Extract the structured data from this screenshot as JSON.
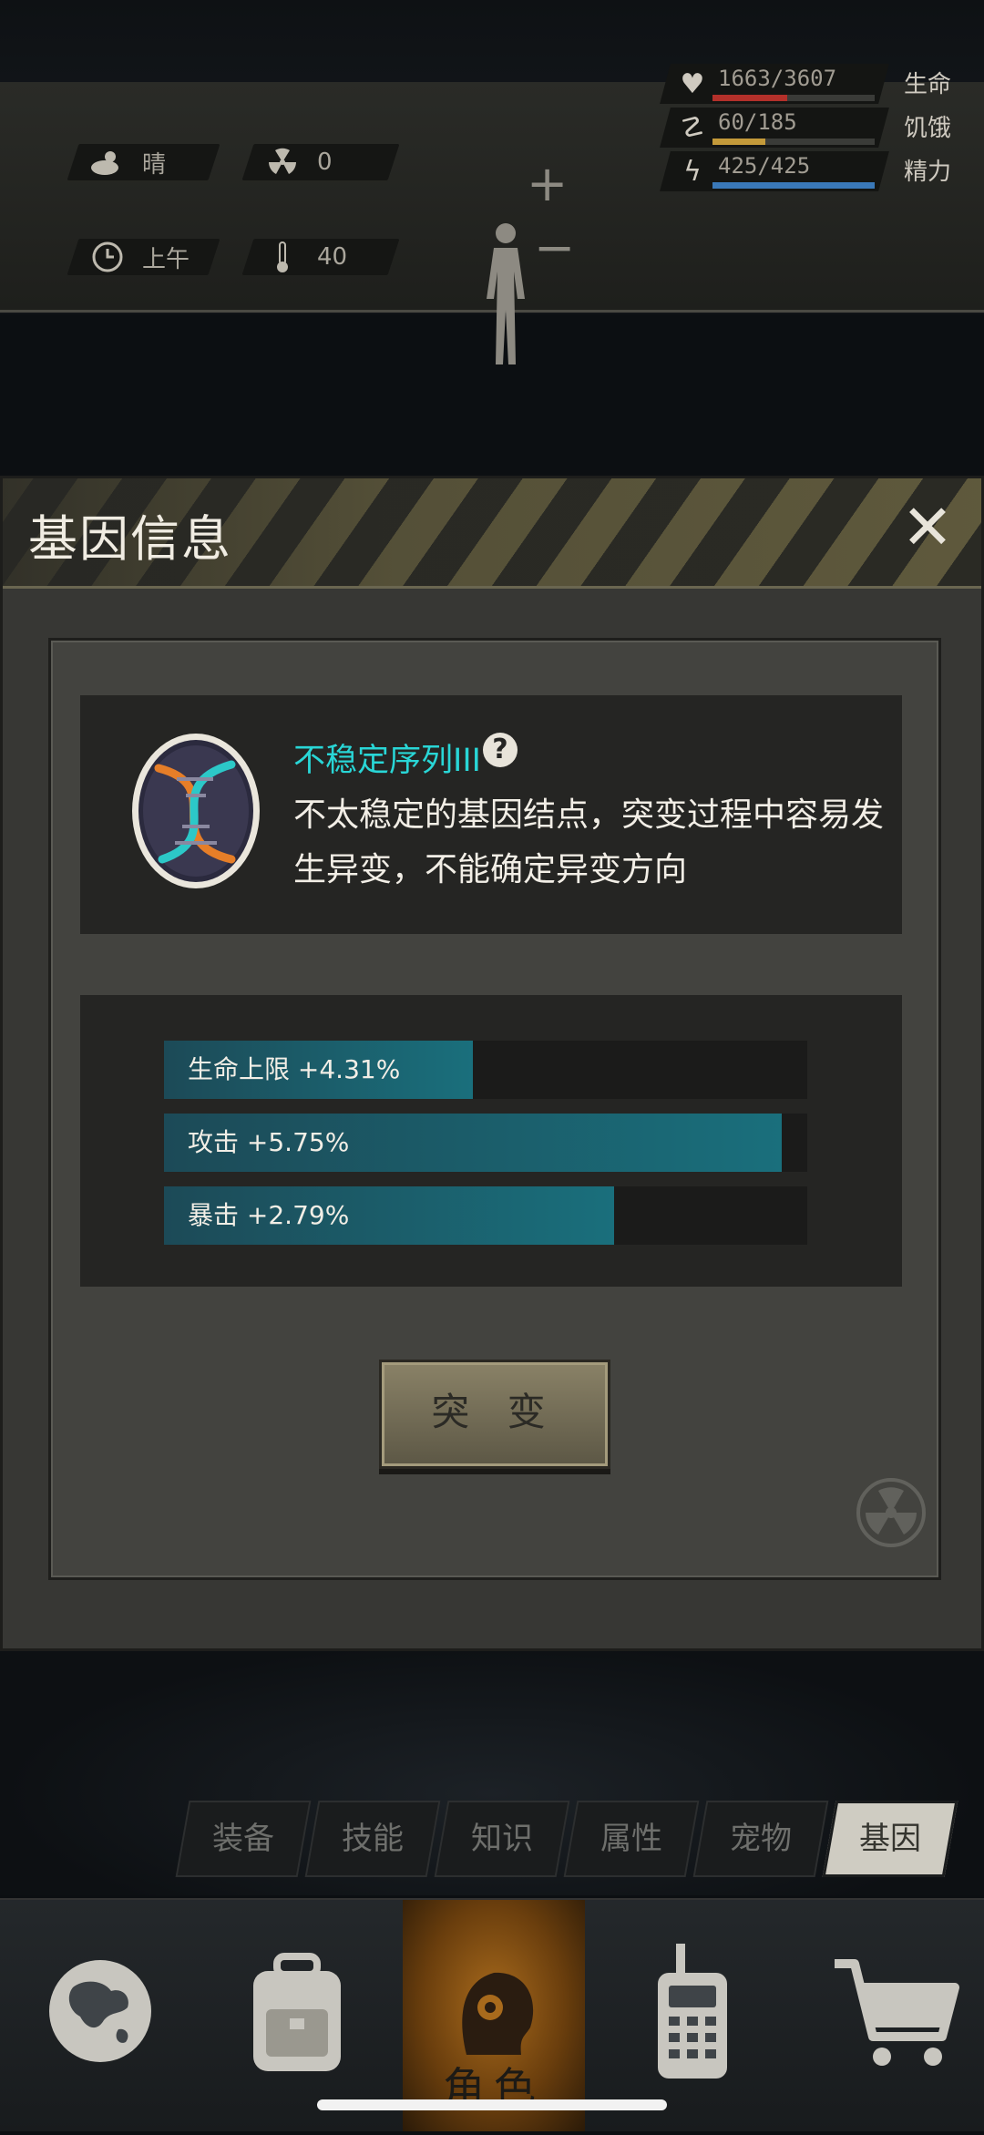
{
  "status": {
    "weather": "晴",
    "radiation": "0",
    "time_of_day": "上午",
    "temperature": "40",
    "stats": [
      {
        "name": "生命",
        "value": "1663/3607",
        "fraction": 0.461,
        "color": "#b3302a",
        "icon": "heart-icon"
      },
      {
        "name": "饥饿",
        "value": "60/185",
        "fraction": 0.324,
        "color": "#c49a3a",
        "icon": "stomach-icon"
      },
      {
        "name": "精力",
        "value": "425/425",
        "fraction": 1.0,
        "color": "#3a78b8",
        "icon": "energy-icon"
      }
    ]
  },
  "dialog": {
    "title": "基因信息",
    "gene": {
      "name": "不稳定序列III",
      "description": "不太稳定的基因结点，突变过程中容易发生异变，不能确定异变方向"
    },
    "attributes": [
      {
        "label": "生命上限 +4.31%",
        "fraction": 0.48
      },
      {
        "label": "攻击 +5.75%",
        "fraction": 0.96
      },
      {
        "label": "暴击 +2.79%",
        "fraction": 0.7
      }
    ],
    "mutate_label": "突 变"
  },
  "tabs": [
    {
      "label": "装备",
      "active": false
    },
    {
      "label": "技能",
      "active": false
    },
    {
      "label": "知识",
      "active": false
    },
    {
      "label": "属性",
      "active": false
    },
    {
      "label": "宠物",
      "active": false
    },
    {
      "label": "基因",
      "active": true
    }
  ],
  "nav": {
    "items": [
      {
        "icon": "globe-icon",
        "label": ""
      },
      {
        "icon": "backpack-icon",
        "label": ""
      },
      {
        "icon": "character-icon",
        "label": "角色",
        "active": true
      },
      {
        "icon": "radio-icon",
        "label": ""
      },
      {
        "icon": "cart-icon",
        "label": ""
      }
    ]
  }
}
